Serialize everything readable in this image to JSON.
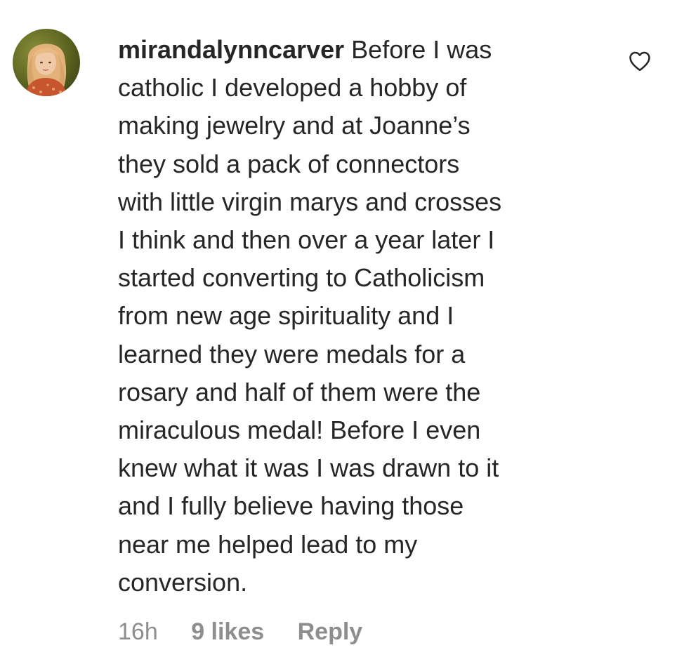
{
  "comment": {
    "username": "mirandalynncarver",
    "avatar_icon": "profile-photo",
    "text_lines": [
      " Before I was",
      "catholic I developed a hobby of",
      "making jewelry and at Joanne’s",
      "they sold a pack of connectors",
      "with little virgin marys and crosses",
      "I think and then over a year later I",
      "started converting to Catholicism",
      "from new age spirituality and I",
      "learned they were medals for a",
      "rosary and half of them were the",
      "miraculous medal! Before I even",
      "knew what it was I was drawn to it",
      "and I fully believe having those",
      "near me helped lead to my",
      "conversion."
    ],
    "like_icon": "heart-outline-icon",
    "timestamp": "16h",
    "likes_label": "9 likes",
    "reply_label": "Reply"
  },
  "colors": {
    "text": "#262626",
    "secondary": "#8e8e8e",
    "background": "#ffffff"
  }
}
